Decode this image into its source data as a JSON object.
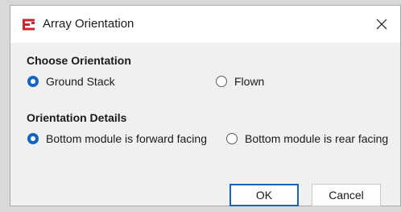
{
  "window": {
    "title": "Array Orientation",
    "close_glyph": "✕",
    "icon": "array-icon",
    "icon_color": "#d0252b"
  },
  "orientation": {
    "heading": "Choose Orientation",
    "options": [
      {
        "label": "Ground Stack",
        "selected": true
      },
      {
        "label": "Flown",
        "selected": false
      }
    ]
  },
  "details": {
    "heading": "Orientation Details",
    "options": [
      {
        "label": "Bottom module is forward facing",
        "selected": true
      },
      {
        "label": "Bottom module is rear facing",
        "selected": false
      }
    ]
  },
  "buttons": {
    "ok_label": "OK",
    "cancel_label": "Cancel"
  },
  "colors": {
    "accent": "#1565c0"
  }
}
